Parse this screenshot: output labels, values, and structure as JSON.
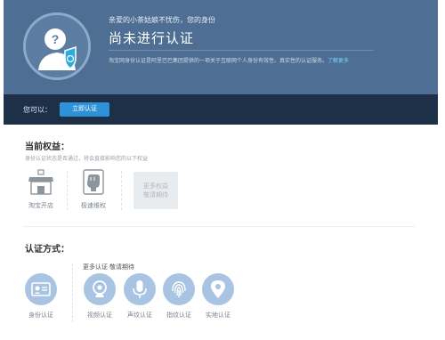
{
  "header": {
    "greeting": "亲爱的小茶姑娘不忧伤，您的身份",
    "status": "尚未进行认证",
    "description": "淘宝网身份认证是阿里巴巴集团提供的一项关于互联网个人身份有效性、真实性的认证服务。",
    "more_link": "了解更多"
  },
  "action": {
    "label": "您可以：",
    "button": "立即认证"
  },
  "rights": {
    "title": "当前权益：",
    "subtitle": "身份认证状态是否通过，将会直接影响您的以下权益",
    "items": [
      {
        "label": "淘宝开店",
        "icon": "shop-icon"
      },
      {
        "label": "极速维权",
        "icon": "fist-icon"
      }
    ],
    "more": [
      "更多权益",
      "敬请期待"
    ]
  },
  "methods": {
    "title": "认证方式：",
    "more_label": "更多认证 敬请期待",
    "items": [
      {
        "label": "身份认证",
        "icon": "id-card-icon"
      },
      {
        "label": "视频认证",
        "icon": "webcam-icon"
      },
      {
        "label": "声纹认证",
        "icon": "microphone-icon"
      },
      {
        "label": "指纹认证",
        "icon": "fingerprint-icon"
      },
      {
        "label": "实地认证",
        "icon": "location-pin-icon"
      }
    ]
  },
  "colors": {
    "header_bg": "#4e6f93",
    "action_bar_bg": "#1e3048",
    "primary_button": "#2e93d6",
    "link": "#7fd0ff",
    "method_circle": "#a9c4e2"
  }
}
